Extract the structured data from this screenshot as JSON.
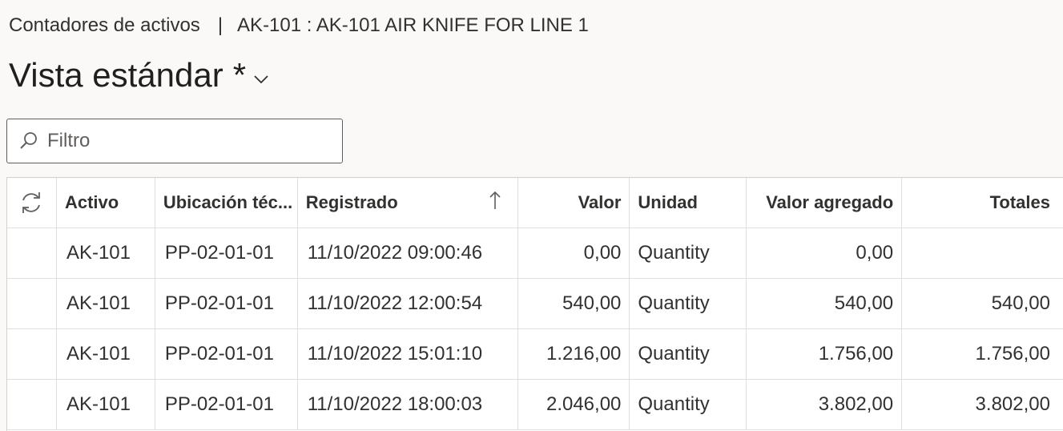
{
  "breadcrumb": {
    "section": "Contadores de activos",
    "separator": "|",
    "record": "AK-101 : AK-101 AIR KNIFE FOR LINE 1"
  },
  "view": {
    "title": "Vista estándar",
    "modified_marker": "*",
    "dropdown_icon": "chevron-down-icon"
  },
  "filter": {
    "placeholder": "Filtro",
    "value": "",
    "icon": "search-icon"
  },
  "grid": {
    "refresh_icon": "refresh-icon",
    "sort_icon": "sort-ascending-icon",
    "columns": [
      "Activo",
      "Ubicación téc...",
      "Registrado",
      "Valor",
      "Unidad",
      "Valor agregado",
      "Totales"
    ],
    "sorted_column": "Registrado",
    "sort_direction": "ascending",
    "rows": [
      {
        "activo": "AK-101",
        "ubicacion": "PP-02-01-01",
        "registrado": "11/10/2022 09:00:46",
        "valor": "0,00",
        "unidad": "Quantity",
        "valor_agregado": "0,00",
        "totales": ""
      },
      {
        "activo": "AK-101",
        "ubicacion": "PP-02-01-01",
        "registrado": "11/10/2022 12:00:54",
        "valor": "540,00",
        "unidad": "Quantity",
        "valor_agregado": "540,00",
        "totales": "540,00"
      },
      {
        "activo": "AK-101",
        "ubicacion": "PP-02-01-01",
        "registrado": "11/10/2022 15:01:10",
        "valor": "1.216,00",
        "unidad": "Quantity",
        "valor_agregado": "1.756,00",
        "totales": "1.756,00"
      },
      {
        "activo": "AK-101",
        "ubicacion": "PP-02-01-01",
        "registrado": "11/10/2022 18:00:03",
        "valor": "2.046,00",
        "unidad": "Quantity",
        "valor_agregado": "3.802,00",
        "totales": "3.802,00"
      }
    ]
  }
}
